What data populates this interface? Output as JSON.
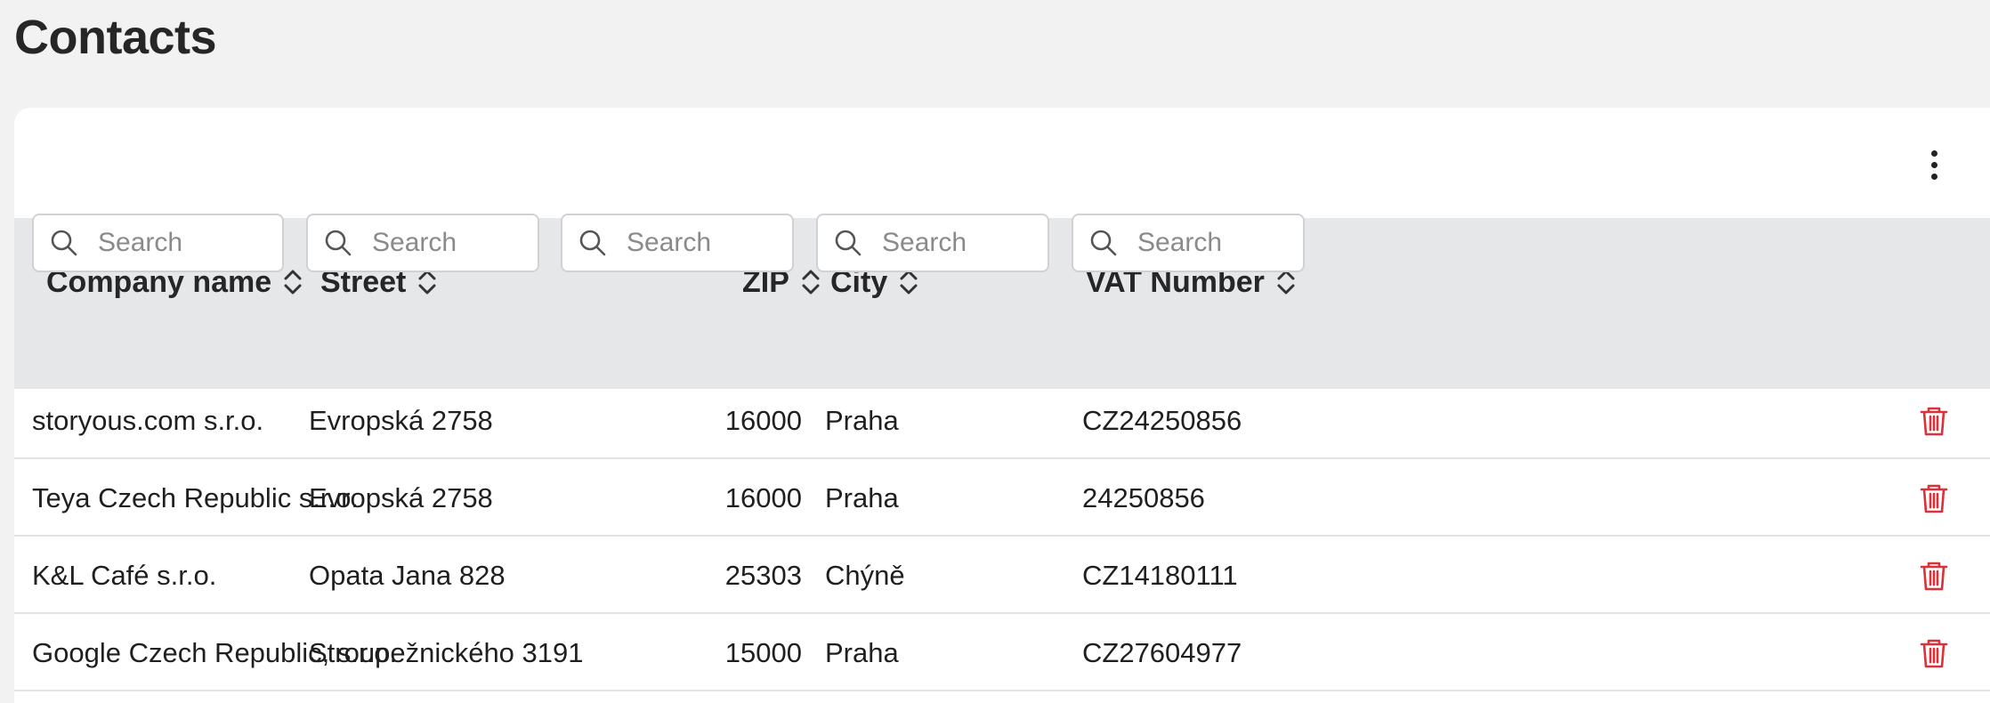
{
  "page": {
    "title": "Contacts"
  },
  "table": {
    "columns": [
      {
        "key": "company",
        "label": "Company name"
      },
      {
        "key": "street",
        "label": "Street"
      },
      {
        "key": "zip",
        "label": "ZIP"
      },
      {
        "key": "city",
        "label": "City"
      },
      {
        "key": "vat",
        "label": "VAT Number"
      }
    ],
    "search_placeholder": "Search",
    "rows": [
      {
        "company": "storyous.com s.r.o.",
        "street": "Evropská 2758",
        "zip": "16000",
        "city": "Praha",
        "vat": "CZ24250856"
      },
      {
        "company": "Teya Czech Republic s.r.o.",
        "street": "Evropská 2758",
        "zip": "16000",
        "city": "Praha",
        "vat": "24250856"
      },
      {
        "company": "K&L Café s.r.o.",
        "street": "Opata Jana 828",
        "zip": "25303",
        "city": "Chýně",
        "vat": "CZ14180111"
      },
      {
        "company": "Google Czech Republic, s.r.o.",
        "street": "Stroupežnického 3191",
        "zip": "15000",
        "city": "Praha",
        "vat": "CZ27604977"
      }
    ]
  },
  "icons": {
    "more": "more-vertical-icon",
    "sort": "sort-icon",
    "search": "search-icon",
    "delete": "trash-icon"
  },
  "colors": {
    "danger": "#d9323a",
    "header_bg": "#e6e7e9"
  }
}
